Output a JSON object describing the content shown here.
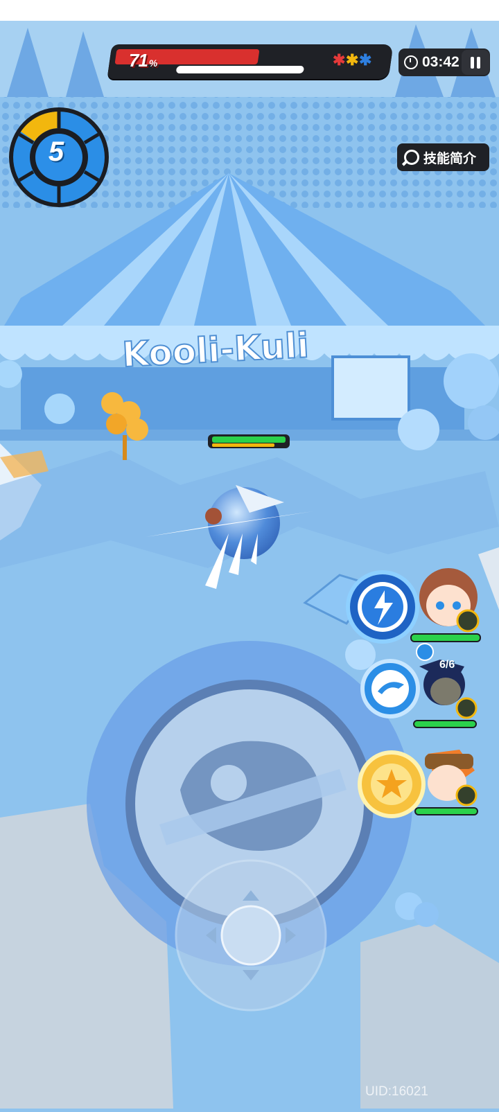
{
  "hud": {
    "hp_percent": "71",
    "hp_percent_sign": "%",
    "hp_level": 0.71,
    "shield_level": 0.55,
    "timer": "03:42",
    "colors": {
      "hp": "#d9302e",
      "panel": "#1f2126",
      "gem_red": "#e53a3a",
      "gem_yellow": "#f2b70e",
      "gem_blue": "#2e7fe0"
    }
  },
  "level": {
    "value": "5"
  },
  "skill_intro": {
    "label": "技能简介"
  },
  "sign": {
    "text": "Kooli-Kuli"
  },
  "party": {
    "charges": "6/6",
    "members": [
      {
        "icon": "lightning-skill-icon"
      },
      {
        "icon": "dolphin-skill-icon"
      },
      {
        "icon": "star-skill-icon"
      }
    ]
  },
  "footer": {
    "uid": "UID:16021"
  },
  "icons": [
    "clock-icon",
    "pause-icon",
    "magnifier-icon",
    "joystick-icon",
    "ultimate-skill-icon"
  ]
}
